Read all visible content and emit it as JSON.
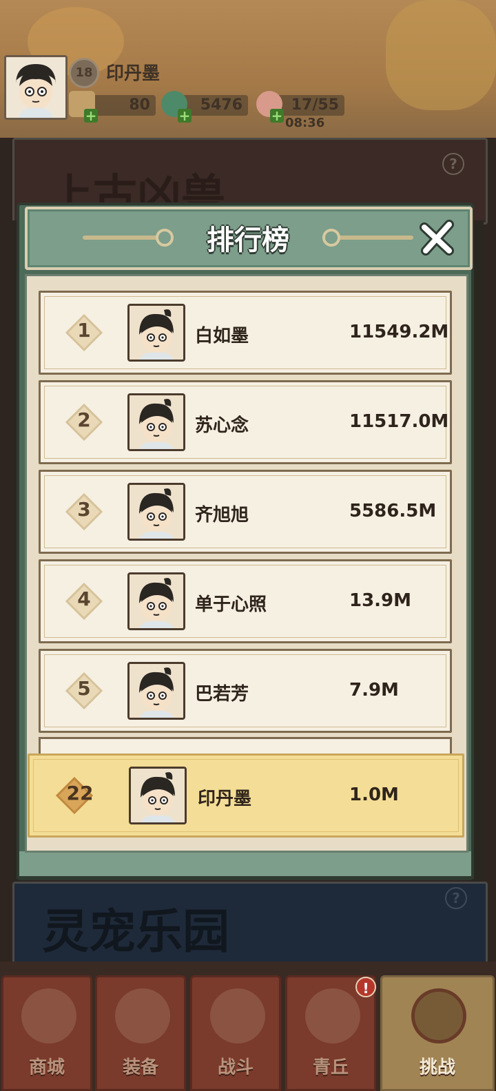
{
  "player": {
    "level": "18",
    "name": "印丹墨",
    "resources": [
      {
        "icon": "scroll-ticket-icon",
        "value": "80"
      },
      {
        "icon": "jade-dragon-icon",
        "value": "5476"
      },
      {
        "icon": "peach-stamina-icon",
        "value": "17/55"
      }
    ],
    "stamina_timer": "08:36"
  },
  "background": {
    "top_banner_text": "上古凶兽",
    "bottom_banner_text": "灵宠乐园",
    "help_glyph": "?"
  },
  "modal": {
    "title": "排行榜",
    "close_glyph": "✕"
  },
  "leaderboard": [
    {
      "rank": "1",
      "name": "白如墨",
      "score": "11549.2M"
    },
    {
      "rank": "2",
      "name": "苏心念",
      "score": "11517.0M"
    },
    {
      "rank": "3",
      "name": "齐旭旭",
      "score": "5586.5M"
    },
    {
      "rank": "4",
      "name": "单于心照",
      "score": "13.9M"
    },
    {
      "rank": "5",
      "name": "巴若芳",
      "score": "7.9M"
    }
  ],
  "self_entry": {
    "rank": "22",
    "name": "印丹墨",
    "score": "1.0M"
  },
  "nav": {
    "tabs": [
      {
        "label": "商城",
        "icon": "shop-icon"
      },
      {
        "label": "装备",
        "icon": "armor-icon"
      },
      {
        "label": "战斗",
        "icon": "crossed-swords-icon"
      },
      {
        "label": "青丘",
        "icon": "mountain-icon"
      },
      {
        "label": "挑战",
        "icon": "challenge-drum-icon"
      }
    ],
    "active_tab": "挑战",
    "badge_glyph": "!"
  },
  "colors": {
    "modal_green": "#7c9e8a",
    "row_bg": "#f6f0e3",
    "self_row_bg": "#f4dd96",
    "nav_tab": "#7a3a2c"
  }
}
